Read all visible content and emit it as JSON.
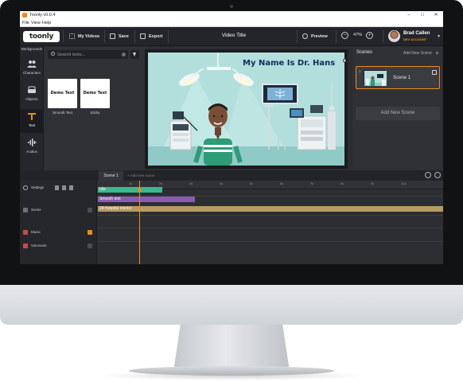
{
  "window": {
    "title": "Toonly v0.0.4",
    "controls": [
      "–",
      "□",
      "✕"
    ]
  },
  "menu": [
    "File",
    "View",
    "Help"
  ],
  "toolbar": {
    "logo": "toonly",
    "my_videos": "My Videos",
    "save": "Save",
    "export": "Export",
    "video_title": "Video Title",
    "preview": "Preview",
    "zoom": "47%",
    "user_name": "Brad Callen",
    "user_role": "DEV ACCOUNT"
  },
  "rail": {
    "header": "Backgrounds",
    "items": [
      {
        "label": "Characters",
        "icon": "characters-icon"
      },
      {
        "label": "Objects",
        "icon": "objects-icon"
      },
      {
        "label": "Text",
        "icon": "text-icon",
        "active": true
      },
      {
        "label": "Audios",
        "icon": "audio-icon"
      }
    ]
  },
  "text_panel": {
    "search_placeholder": "Search texts...",
    "cards": [
      {
        "preview": "Demo Text",
        "caption": "Smooth Text"
      },
      {
        "preview": "Demo Text",
        "caption": "Sticky"
      }
    ]
  },
  "canvas": {
    "heading": "My Name Is Dr. Hans"
  },
  "scenes_panel": {
    "title": "Scenes",
    "add_link": "Add New Scene",
    "scene_number": "1",
    "scene_name": "Scene 1",
    "add_button": "Add New Scene"
  },
  "timeline": {
    "tab": "Scene 1",
    "add_scene": "Add new scene",
    "settings": "Settings",
    "tracks": [
      "Scene",
      "Music",
      "Voiceover"
    ],
    "ruler_labels": [
      "1s",
      "2s",
      "3s",
      "4s",
      "5s",
      "6s",
      "7s",
      "8s",
      "9s",
      "10s"
    ],
    "bars": [
      {
        "label": "Idle",
        "color": "#3fb68f"
      },
      {
        "label": "Smooth text",
        "color": "#8a5bb0"
      },
      {
        "label": "24 hospital interior",
        "color": "#b79a63"
      }
    ]
  },
  "colors": {
    "accent": "#f08b19",
    "scene_bg": "#b2dfdc",
    "heading": "#0d2d5a"
  }
}
